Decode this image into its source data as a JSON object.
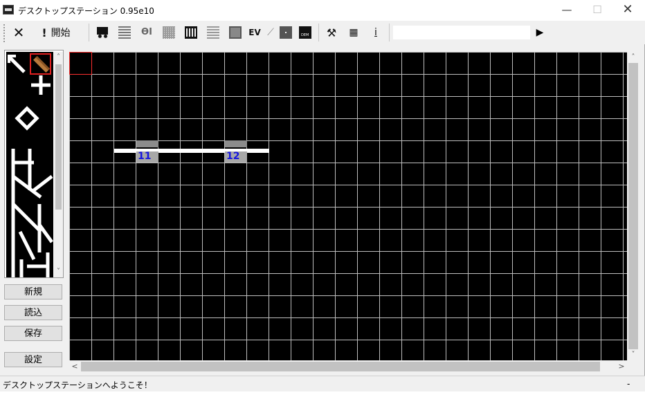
{
  "window": {
    "title": "デスクトップステーション 0.95e10"
  },
  "titlebar": {
    "minimize": "—",
    "maximize": "☐",
    "close": "✕"
  },
  "toolbar": {
    "stop_glyph": "✕",
    "start_label": "開始",
    "start_glyph": "!",
    "ev_label": "EV",
    "hammer_glyph": "⚒",
    "calc_glyph": "▦",
    "info_glyph": "i",
    "command_value": "",
    "run_glyph": "▶",
    "icons": [
      "train-icon",
      "stack-icon",
      "coupler-icon",
      "grid-icon",
      "rail-icon",
      "list-icon",
      "chip-icon",
      "ev-icon",
      "signal-icon",
      "tiles-icon",
      "dem-icon",
      "hammer-icon",
      "calculator-icon",
      "info-icon"
    ]
  },
  "palette": {
    "up": "˄",
    "down": "˅"
  },
  "sidebar": {
    "new_label": "新規",
    "load_label": "読込",
    "save_label": "保存",
    "settings_label": "設定"
  },
  "layout": {
    "blocks": [
      {
        "number": "11"
      },
      {
        "number": "12"
      }
    ]
  },
  "scroll": {
    "up": "˄",
    "down": "˅",
    "left": "<",
    "right": ">"
  },
  "status": {
    "message": "デスクトップステーションへようこそ！",
    "right": "-"
  }
}
